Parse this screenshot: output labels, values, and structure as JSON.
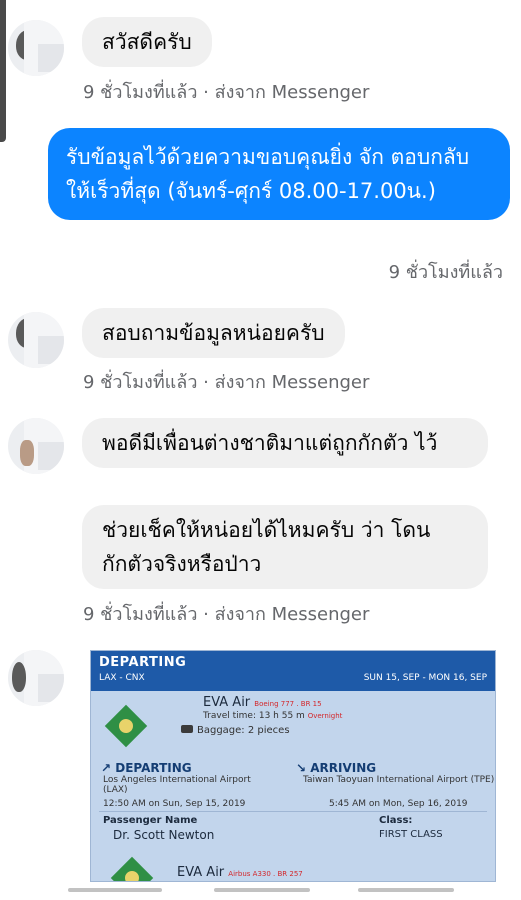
{
  "conversation": {
    "messages": [
      {
        "text": "สวัสดีครับ",
        "meta": "9 ชั่วโมงที่แล้ว · ส่งจาก Messenger"
      },
      {
        "text": "รับข้อมูลไว้ด้วยความขอบคุณยิ่ง จัก ตอบกลับให้เร็วที่สุด (จันทร์-ศุกร์ 08.00-17.00น.)",
        "meta": "9 ชั่วโมงที่แล้ว"
      },
      {
        "text": "สอบถามข้อมูลหน่อยครับ",
        "meta": "9 ชั่วโมงที่แล้ว · ส่งจาก Messenger"
      },
      {
        "text": "พอดีมีเพื่อนต่างชาติมาแต่ถูกกักตัว ไว้",
        "meta": ""
      },
      {
        "text": "ช่วยเช็คให้หน่อยได้ไหมครับ ว่า โดนกักตัวจริงหรือป่าว",
        "meta": "9 ชั่วโมงที่แล้ว · ส่งจาก Messenger"
      }
    ]
  },
  "ticket": {
    "header": "DEPARTING",
    "route": "LAX - CNX",
    "dates": "SUN 15, SEP - MON 16, SEP",
    "airline": "EVA Air",
    "aircraft": "Boeing 777 . BR 15",
    "travel_time": "Travel time: 13 h 55 m",
    "overnight": "Overnight",
    "baggage": "Baggage: 2 pieces",
    "departing_label": "DEPARTING",
    "departing_airport": "Los Angeles International Airport",
    "departing_code": "(LAX)",
    "departing_time": "12:50 AM on Sun, Sep 15, 2019",
    "arriving_label": "ARRIVING",
    "arriving_airport": "Taiwan Taoyuan International Airport (TPE)",
    "arriving_time": "5:45 AM on Mon, Sep 16, 2019",
    "passenger_label": "Passenger Name",
    "passenger_name": "Dr. Scott Newton",
    "class_label": "Class:",
    "class_value": "FIRST CLASS",
    "airline2": "EVA Air",
    "aircraft2": "Airbus A330 . BR 257"
  },
  "colors": {
    "outgoing_bubble": "#0c84ff",
    "incoming_bubble": "#f0f0f0",
    "meta_text": "#65676b"
  }
}
